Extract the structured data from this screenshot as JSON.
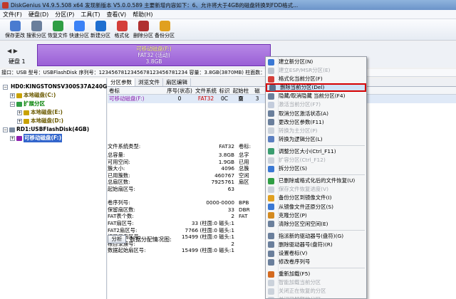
{
  "window": {
    "title": "DiskGenius V4.9.5.508 x64   发现新版本 V5.0.0.589 主要新增内容如下：6、允许将大于4GB的磁盘转换到FDD格式..."
  },
  "menubar": [
    "文件(F)",
    "硬盘(D)",
    "分区(P)",
    "工具(T)",
    "查看(V)",
    "帮助(H)"
  ],
  "toolbar": [
    {
      "label": "保存更改",
      "icon": "save-icon",
      "color": "#4a7bd0"
    },
    {
      "label": "搜索分区",
      "icon": "search-icon",
      "color": "#6a7f9c"
    },
    {
      "label": "恢复文件",
      "icon": "recover-icon",
      "color": "#2f9e44"
    },
    {
      "label": "快速分区",
      "icon": "quick-partition-icon",
      "color": "#3b82f6"
    },
    {
      "label": "新建分区",
      "icon": "new-partition-icon",
      "color": "#1f6fd0"
    },
    {
      "label": "格式化",
      "icon": "format-icon",
      "color": "#d43f3a"
    },
    {
      "label": "删除分区",
      "icon": "delete-partition-icon",
      "color": "#b03030"
    },
    {
      "label": "备份分区",
      "icon": "backup-icon",
      "color": "#e0a020"
    }
  ],
  "disk_strip": {
    "nav": "◀ ▶",
    "disk_label": "硬盘 1",
    "partition_name": "可移动磁盘(F:)",
    "partition_fs": "FAT32 (活动)",
    "partition_size": "3.8GB"
  },
  "infoline": "接口：USB   型号：USBFlashDisk   序列号：1234567812345678123456781234   容量：3.8GB(3870MB)   柱面数：493   磁头数：255   每",
  "tree": [
    {
      "text": "HD0:KINGSTONSV300S37A240G(224GB)",
      "style": "t-disk",
      "indent": 0,
      "twisty": "−"
    },
    {
      "text": "本地磁盘(C:)",
      "style": "t-yellow",
      "indent": 1,
      "twisty": "+"
    },
    {
      "text": "扩展分区",
      "style": "t-green",
      "indent": 1,
      "twisty": "−"
    },
    {
      "text": "本地磁盘(E:)",
      "style": "t-yellow",
      "indent": 2,
      "twisty": "+"
    },
    {
      "text": "本地磁盘(D:)",
      "style": "t-yellow",
      "indent": 2,
      "twisty": "+"
    },
    {
      "text": "RD1:USBFlashDisk(4GB)",
      "style": "t-disk",
      "indent": 0,
      "twisty": "−"
    },
    {
      "text": "可移动磁盘(F:)",
      "style": "t-purple",
      "indent": 1,
      "twisty": "+",
      "selected": true
    }
  ],
  "tabs": [
    "分区参数",
    "浏览文件",
    "扇区编辑"
  ],
  "grid": {
    "headers": [
      "卷标",
      "序号(状态)",
      "文件系统",
      "标识",
      "起始柱面",
      "磁"
    ],
    "row": {
      "name": "可移动磁盘(F:)",
      "seq": "0",
      "fs": "FAT32",
      "id": "0C",
      "cyl": "0",
      "extra": "3"
    }
  },
  "details": {
    "header": {
      "k": "文件系统类型:",
      "v": "FAT32",
      "k2": "卷标:"
    },
    "rows": [
      {
        "k": "总容量:",
        "v": "3.8GB",
        "k2": "总字"
      },
      {
        "k": "可用空间:",
        "v": "1.9GB",
        "k2": "已用"
      },
      {
        "k": "簇大小:",
        "v": "4096",
        "k2": "总簇"
      },
      {
        "k": "已用簇数:",
        "v": "460767",
        "k2": "空闲"
      },
      {
        "k": "总扇区数:",
        "v": "7925761",
        "k2": "扇区"
      },
      {
        "k": "起始扇区号:",
        "v": "63",
        "k2": ""
      },
      {
        "k": "",
        "v": "",
        "k2": ""
      },
      {
        "k": "卷序列号:",
        "v": "0000-0000",
        "k2": "BPB"
      },
      {
        "k": "保留扇区数:",
        "v": "33",
        "k2": "DBR"
      },
      {
        "k": "FAT表个数:",
        "v": "2",
        "k2": "FAT"
      },
      {
        "k": "FAT扇区号:",
        "v": "33 (柱面:0 磁头:1",
        "k2": ""
      },
      {
        "k": "FAT2扇区号:",
        "v": "7766 (柱面:0 磁头:1",
        "k2": ""
      },
      {
        "k": "根目录扇区号:",
        "v": "15499 (柱面:0 磁头:1",
        "k2": ""
      },
      {
        "k": "根目录簇号:",
        "v": "2",
        "k2": ""
      },
      {
        "k": "数据起始扇区号:",
        "v": "15499 (柱面:0 磁头:1",
        "k2": ""
      }
    ],
    "analyze_button": "分析",
    "analyze_caption": "数据分配情况图:"
  },
  "context_menu": [
    {
      "label": "建立新分区(N)",
      "icon": "new-partition-icon",
      "color": "#3a78d4",
      "disabled": false
    },
    {
      "label": "建立ESP/MSR分区(E)",
      "icon": "esp-icon",
      "color": "#7a8aa0",
      "disabled": true
    },
    {
      "label": "格式化当前分区(F)",
      "icon": "format-icon",
      "color": "#d43f3a",
      "disabled": false
    },
    {
      "label": "删除当前分区(Del)",
      "icon": "delete-partition-icon",
      "color": "#5b6f8c",
      "disabled": false,
      "highlight": true
    },
    {
      "label": "隐藏/取消隐藏 当前分区(F4)",
      "icon": "hide-icon",
      "color": "#6a7f9c",
      "disabled": false
    },
    {
      "label": "激活当前分区(F7)",
      "icon": "activate-icon",
      "color": "#8899bb",
      "disabled": true
    },
    {
      "label": "取消分区激活状态(A)",
      "icon": "deactivate-icon",
      "color": "#6a7f9c",
      "disabled": false
    },
    {
      "label": "更改分区参数(F11)",
      "icon": "params-icon",
      "color": "#6a7f9c",
      "disabled": false
    },
    {
      "label": "转换为主分区(P)",
      "icon": "convert-primary-icon",
      "color": "#9aa6b8",
      "disabled": true
    },
    {
      "label": "转换为逻辑分区(L)",
      "icon": "convert-logical-icon",
      "color": "#5b7fc0",
      "disabled": false
    },
    {
      "sep": true
    },
    {
      "label": "调整分区大小(Ctrl_F11)",
      "icon": "resize-icon",
      "color": "#3a9d6f",
      "disabled": false
    },
    {
      "label": "扩容分区(Ctrl_F12)",
      "icon": "expand-icon",
      "color": "#9aa6b8",
      "disabled": true
    },
    {
      "label": "拆分分区(S)",
      "icon": "split-icon",
      "color": "#3a78d4",
      "disabled": false
    },
    {
      "sep": true
    },
    {
      "label": "已删除或格式化后的文件恢复(U)",
      "icon": "recover-icon",
      "color": "#2f9e44",
      "disabled": false
    },
    {
      "label": "保存文件恢复进度(V)",
      "icon": "save-progress-icon",
      "color": "#9aa6b8",
      "disabled": true
    },
    {
      "label": "备份分区到镜像文件(I)",
      "icon": "backup-icon",
      "color": "#e0a020",
      "disabled": false
    },
    {
      "label": "从镜像文件还原分区(S)",
      "icon": "restore-icon",
      "color": "#3a78d4",
      "disabled": false
    },
    {
      "label": "克隆分区(P)",
      "icon": "clone-icon",
      "color": "#d48a20",
      "disabled": false
    },
    {
      "label": "清除分区空闲空间(E)",
      "icon": "wipe-icon",
      "color": "#6a7f9c",
      "disabled": false
    },
    {
      "sep": true
    },
    {
      "label": "指派新的驱动器号(盘符)(G)",
      "icon": "assign-letter-icon",
      "color": "#6a7f9c",
      "disabled": false
    },
    {
      "label": "删除驱动器号(盘符)(R)",
      "icon": "remove-letter-icon",
      "color": "#6a7f9c",
      "disabled": false
    },
    {
      "label": "设置卷标(V)",
      "icon": "label-icon",
      "color": "#6a7f9c",
      "disabled": false
    },
    {
      "label": "修改卷序列号",
      "icon": "serial-icon",
      "color": "#6a7f9c",
      "disabled": false
    },
    {
      "sep": true
    },
    {
      "label": "重新加载(F5)",
      "icon": "reload-icon",
      "color": "#d46a20",
      "disabled": false
    },
    {
      "label": "智能加载当前分区",
      "icon": "smart-load-icon",
      "color": "#9aa6b8",
      "disabled": true
    },
    {
      "label": "关闭正在恢复的分区",
      "icon": "close-recover-icon",
      "color": "#9aa6b8",
      "disabled": true
    },
    {
      "label": "关闭已解释的分区",
      "icon": "close-parsed-icon",
      "color": "#9aa6b8",
      "disabled": true
    },
    {
      "label": "打开16进制扇区编辑",
      "icon": "hex-editor-icon",
      "color": "#6a7f9c",
      "disabled": false
    }
  ]
}
